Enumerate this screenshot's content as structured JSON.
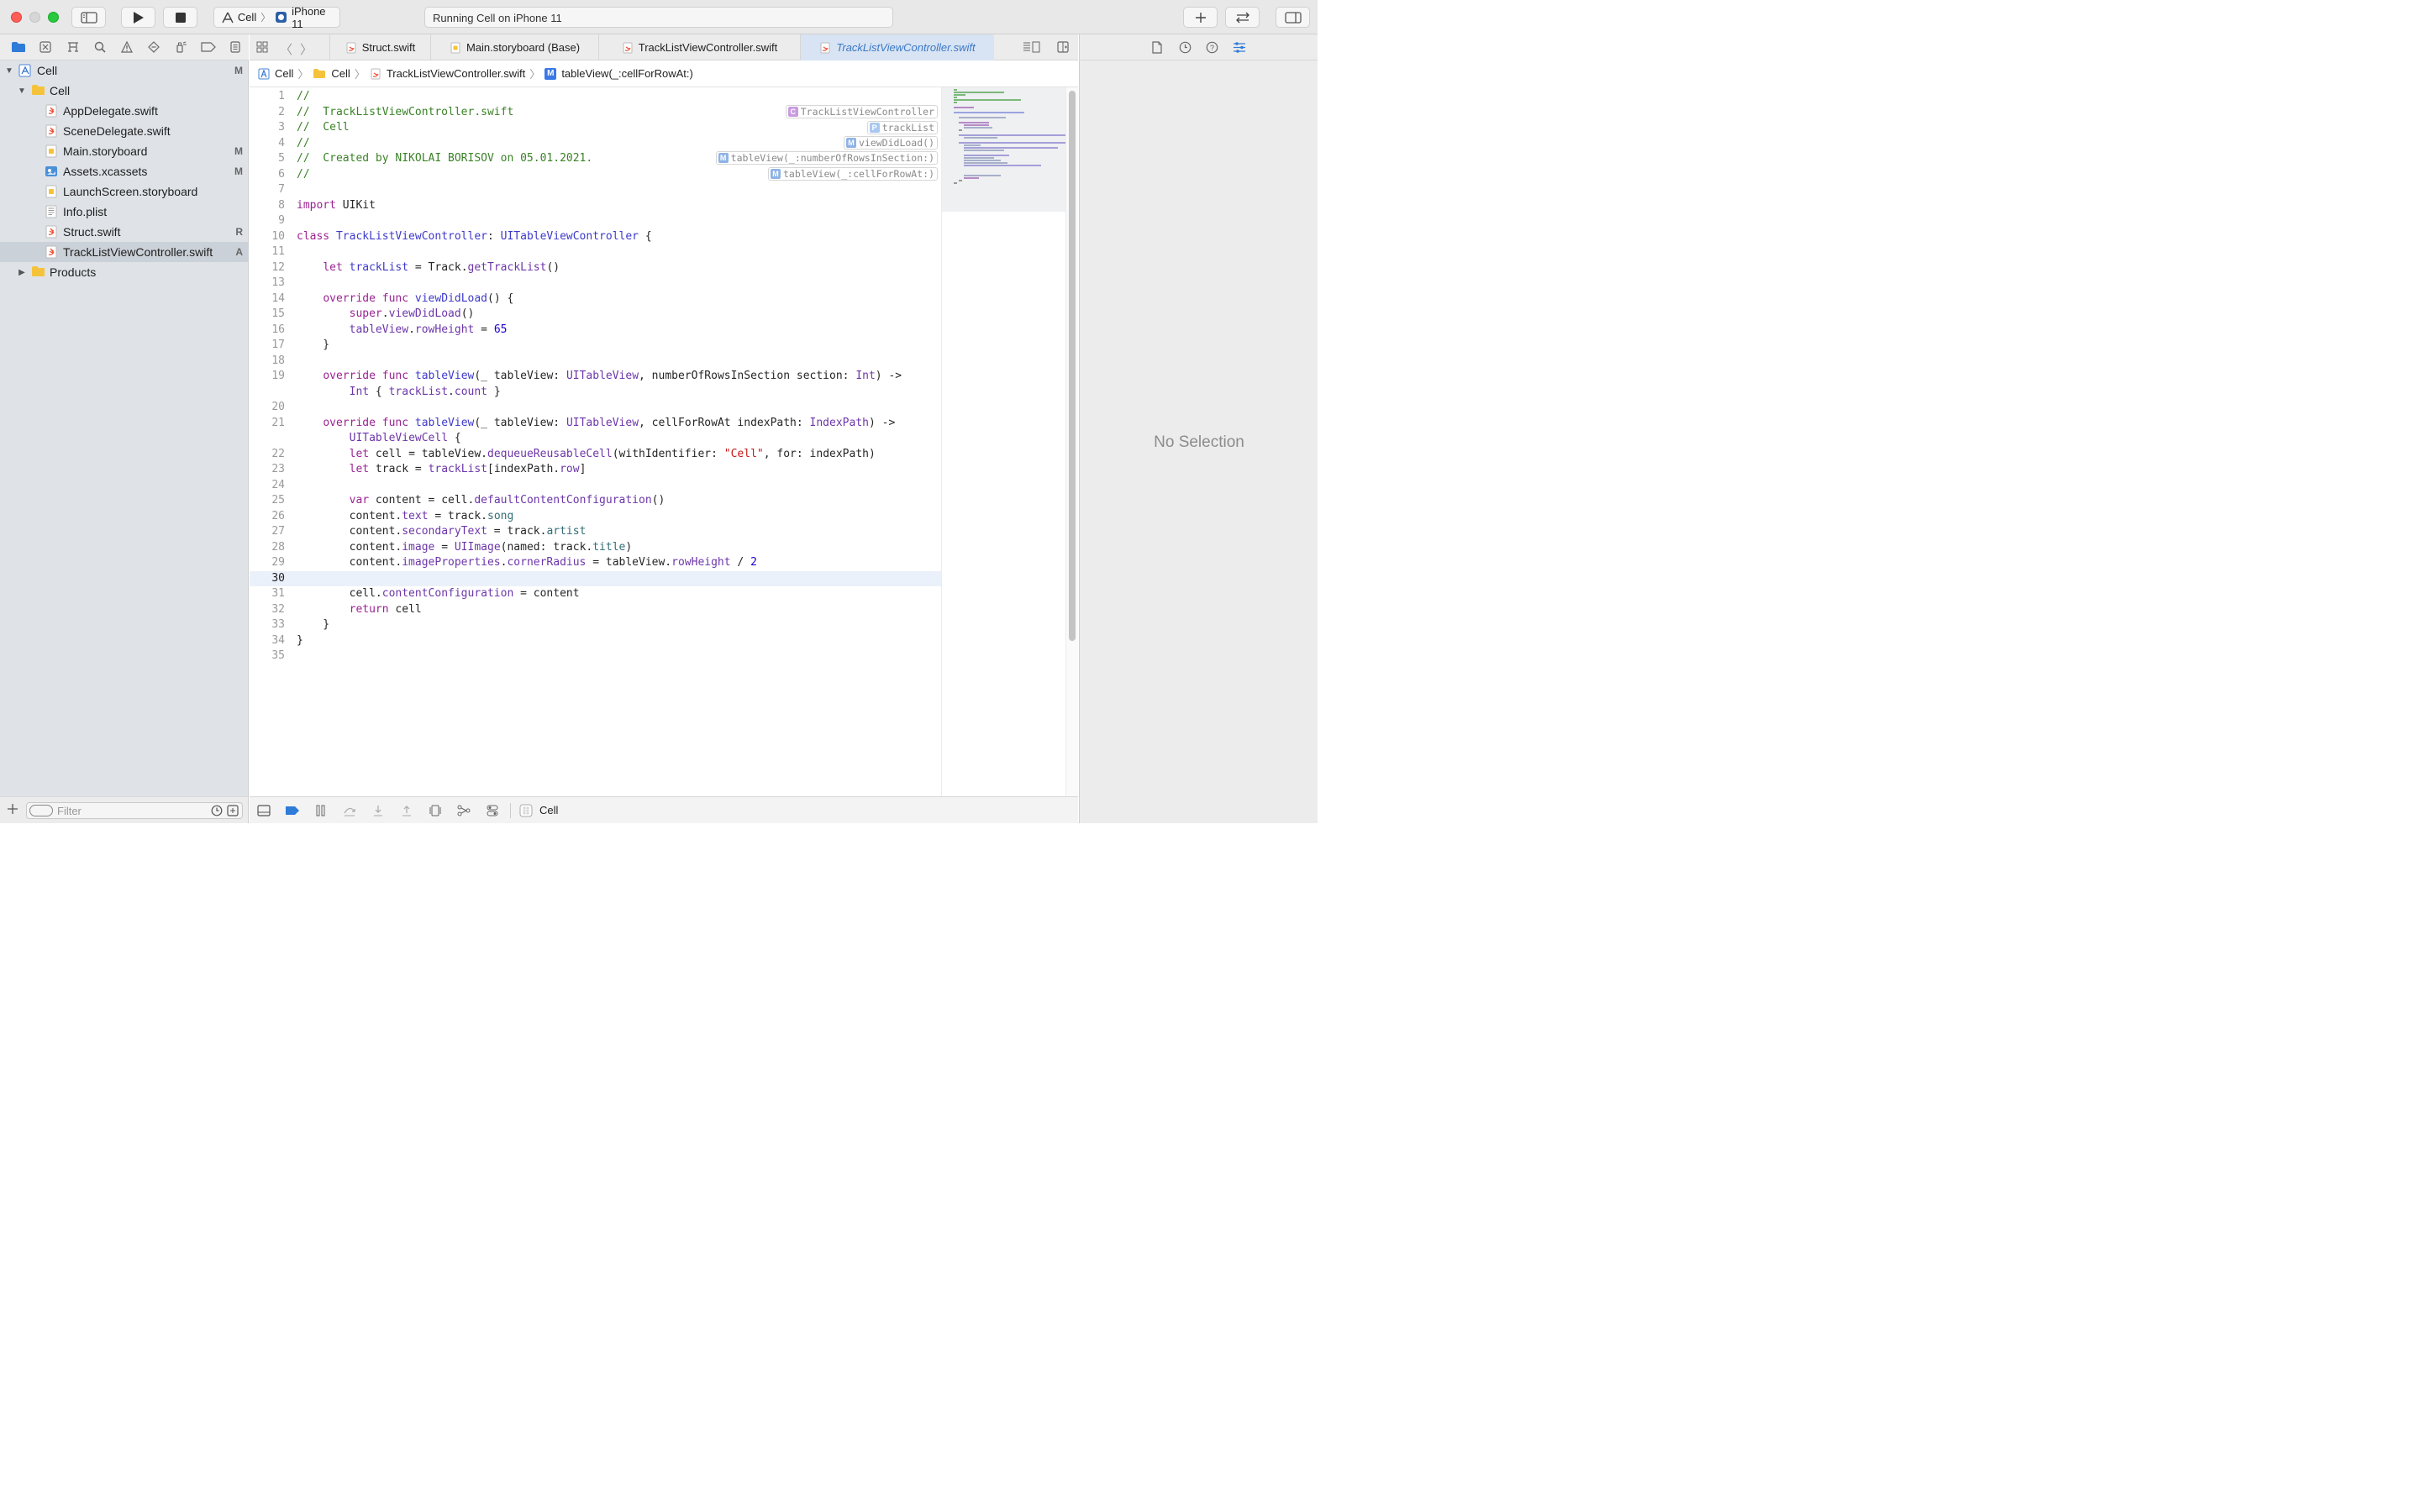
{
  "toolbar": {
    "scheme_target": "Cell",
    "scheme_device": "iPhone 11",
    "activity_status": "Running Cell on iPhone 11"
  },
  "navigator": {
    "tree": [
      {
        "label": "Cell",
        "status": "M"
      },
      {
        "label": "Cell",
        "status": ""
      },
      {
        "label": "AppDelegate.swift",
        "status": ""
      },
      {
        "label": "SceneDelegate.swift",
        "status": ""
      },
      {
        "label": "Main.storyboard",
        "status": "M"
      },
      {
        "label": "Assets.xcassets",
        "status": "M"
      },
      {
        "label": "LaunchScreen.storyboard",
        "status": ""
      },
      {
        "label": "Info.plist",
        "status": ""
      },
      {
        "label": "Struct.swift",
        "status": "R"
      },
      {
        "label": "TrackListViewController.swift",
        "status": "A"
      },
      {
        "label": "Products",
        "status": ""
      }
    ],
    "filter_placeholder": "Filter"
  },
  "tabs": [
    {
      "label": "Struct.swift"
    },
    {
      "label": "Main.storyboard (Base)"
    },
    {
      "label": "TrackListViewController.swift"
    },
    {
      "label": "TrackListViewController.swift"
    }
  ],
  "jumpbar": {
    "project": "Cell",
    "group": "Cell",
    "file": "TrackListViewController.swift",
    "symbol": "tableView(_:cellForRowAt:)"
  },
  "editor": {
    "current_line": 30,
    "line_numbers": [
      "1",
      "2",
      "3",
      "4",
      "5",
      "6",
      "7",
      "8",
      "9",
      "10",
      "11",
      "12",
      "13",
      "14",
      "15",
      "16",
      "17",
      "18",
      "19",
      "",
      "20",
      "21",
      "",
      "22",
      "23",
      "24",
      "25",
      "26",
      "27",
      "28",
      "29",
      "30",
      "31",
      "32",
      "33",
      "34",
      "35"
    ],
    "annotations": [
      {
        "kind": "C",
        "label": "TrackListViewController"
      },
      {
        "kind": "P",
        "label": "trackList"
      },
      {
        "kind": "M",
        "label": "viewDidLoad()"
      },
      {
        "kind": "M",
        "label": "tableView(_:numberOfRowsInSection:)"
      },
      {
        "kind": "M",
        "label": "tableView(_:cellForRowAt:)"
      }
    ]
  },
  "debug": {
    "process_label": "Cell"
  },
  "inspector": {
    "empty_text": "No Selection"
  },
  "colors": {
    "comment": "#3a8226",
    "keyword": "#9b2393",
    "type": "#3d39c9",
    "function": "#6c36a9",
    "string": "#c41a16",
    "number": "#1c00cf",
    "accent": "#3b78c6"
  }
}
